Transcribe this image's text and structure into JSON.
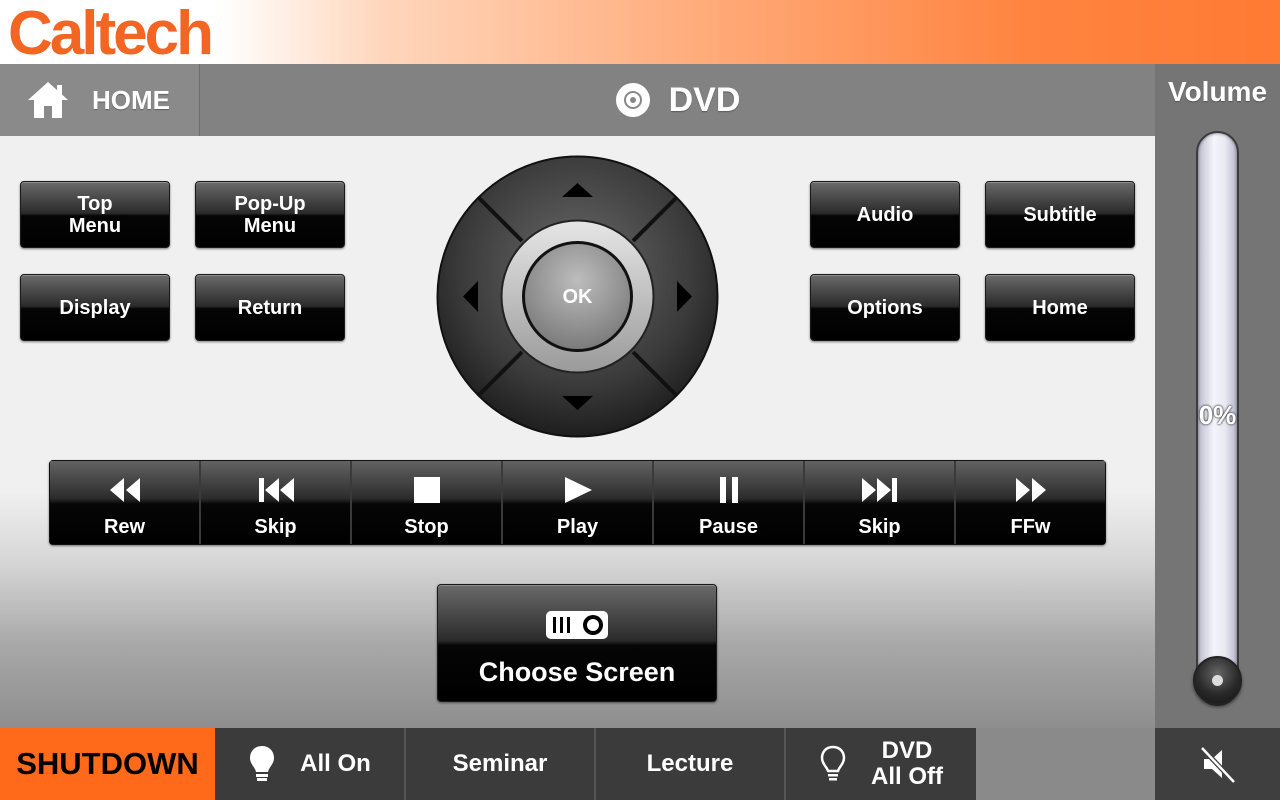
{
  "brand": {
    "logo_text": "Caltech",
    "accent": "#f26522"
  },
  "header": {
    "home_label": "HOME",
    "page_title": "DVD"
  },
  "menu_buttons": {
    "top_menu": "Top\nMenu",
    "popup_menu": "Pop-Up\nMenu",
    "display": "Display",
    "return": "Return",
    "audio": "Audio",
    "subtitle": "Subtitle",
    "options": "Options",
    "home": "Home"
  },
  "dpad": {
    "ok_label": "OK"
  },
  "transport": [
    {
      "label": "Rew",
      "icon": "rewind-icon"
    },
    {
      "label": "Skip",
      "icon": "skip-back-icon"
    },
    {
      "label": "Stop",
      "icon": "stop-icon"
    },
    {
      "label": "Play",
      "icon": "play-icon"
    },
    {
      "label": "Pause",
      "icon": "pause-icon"
    },
    {
      "label": "Skip",
      "icon": "skip-forward-icon"
    },
    {
      "label": "FFw",
      "icon": "fast-forward-icon"
    }
  ],
  "choose_screen": {
    "label": "Choose Screen",
    "icon": "projector-icon"
  },
  "volume": {
    "title": "Volume",
    "level_text": "0%",
    "level": 0
  },
  "bottom": {
    "shutdown": "SHUTDOWN",
    "all_on": "All On",
    "seminar": "Seminar",
    "lecture": "Lecture",
    "dvd_all_off": "DVD\nAll Off",
    "mute_icon": "speaker-muted-icon"
  },
  "colors": {
    "shutdown_bg": "#ff6a1a",
    "header_bg": "#828282",
    "panel_bg": "#757575"
  }
}
